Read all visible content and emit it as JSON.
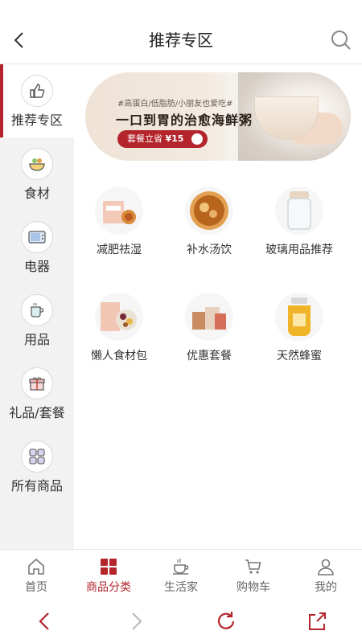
{
  "header": {
    "title": "推荐专区"
  },
  "sidebar": {
    "items": [
      {
        "label": "推荐专区",
        "icon": "thumbs-up-icon",
        "active": true
      },
      {
        "label": "食材",
        "icon": "food-bowl-icon"
      },
      {
        "label": "电器",
        "icon": "microwave-icon"
      },
      {
        "label": "用品",
        "icon": "cup-icon"
      },
      {
        "label": "礼品/套餐",
        "icon": "gift-icon"
      },
      {
        "label": "所有商品",
        "icon": "grid-icon"
      }
    ]
  },
  "banner": {
    "tagline": "#高蛋白/低脂肪/小朋友也爱吃#",
    "headline": "一口到胃的治愈海鲜粥",
    "pill_text": "套餐立省",
    "pill_price": "¥15"
  },
  "categories": [
    {
      "label": "减肥祛湿"
    },
    {
      "label": "补水汤饮"
    },
    {
      "label": "玻璃用品推荐"
    },
    {
      "label": "懒人食材包"
    },
    {
      "label": "优惠套餐"
    },
    {
      "label": "天然蜂蜜"
    }
  ],
  "tabbar": {
    "items": [
      {
        "label": "首页",
        "icon": "home-icon"
      },
      {
        "label": "商品分类",
        "icon": "category-icon",
        "active": true
      },
      {
        "label": "生活家",
        "icon": "teacup-icon"
      },
      {
        "label": "购物车",
        "icon": "cart-icon"
      },
      {
        "label": "我的",
        "icon": "user-icon"
      }
    ]
  },
  "colors": {
    "accent": "#b3242b",
    "sidebar_bg": "#f2f2f2"
  }
}
